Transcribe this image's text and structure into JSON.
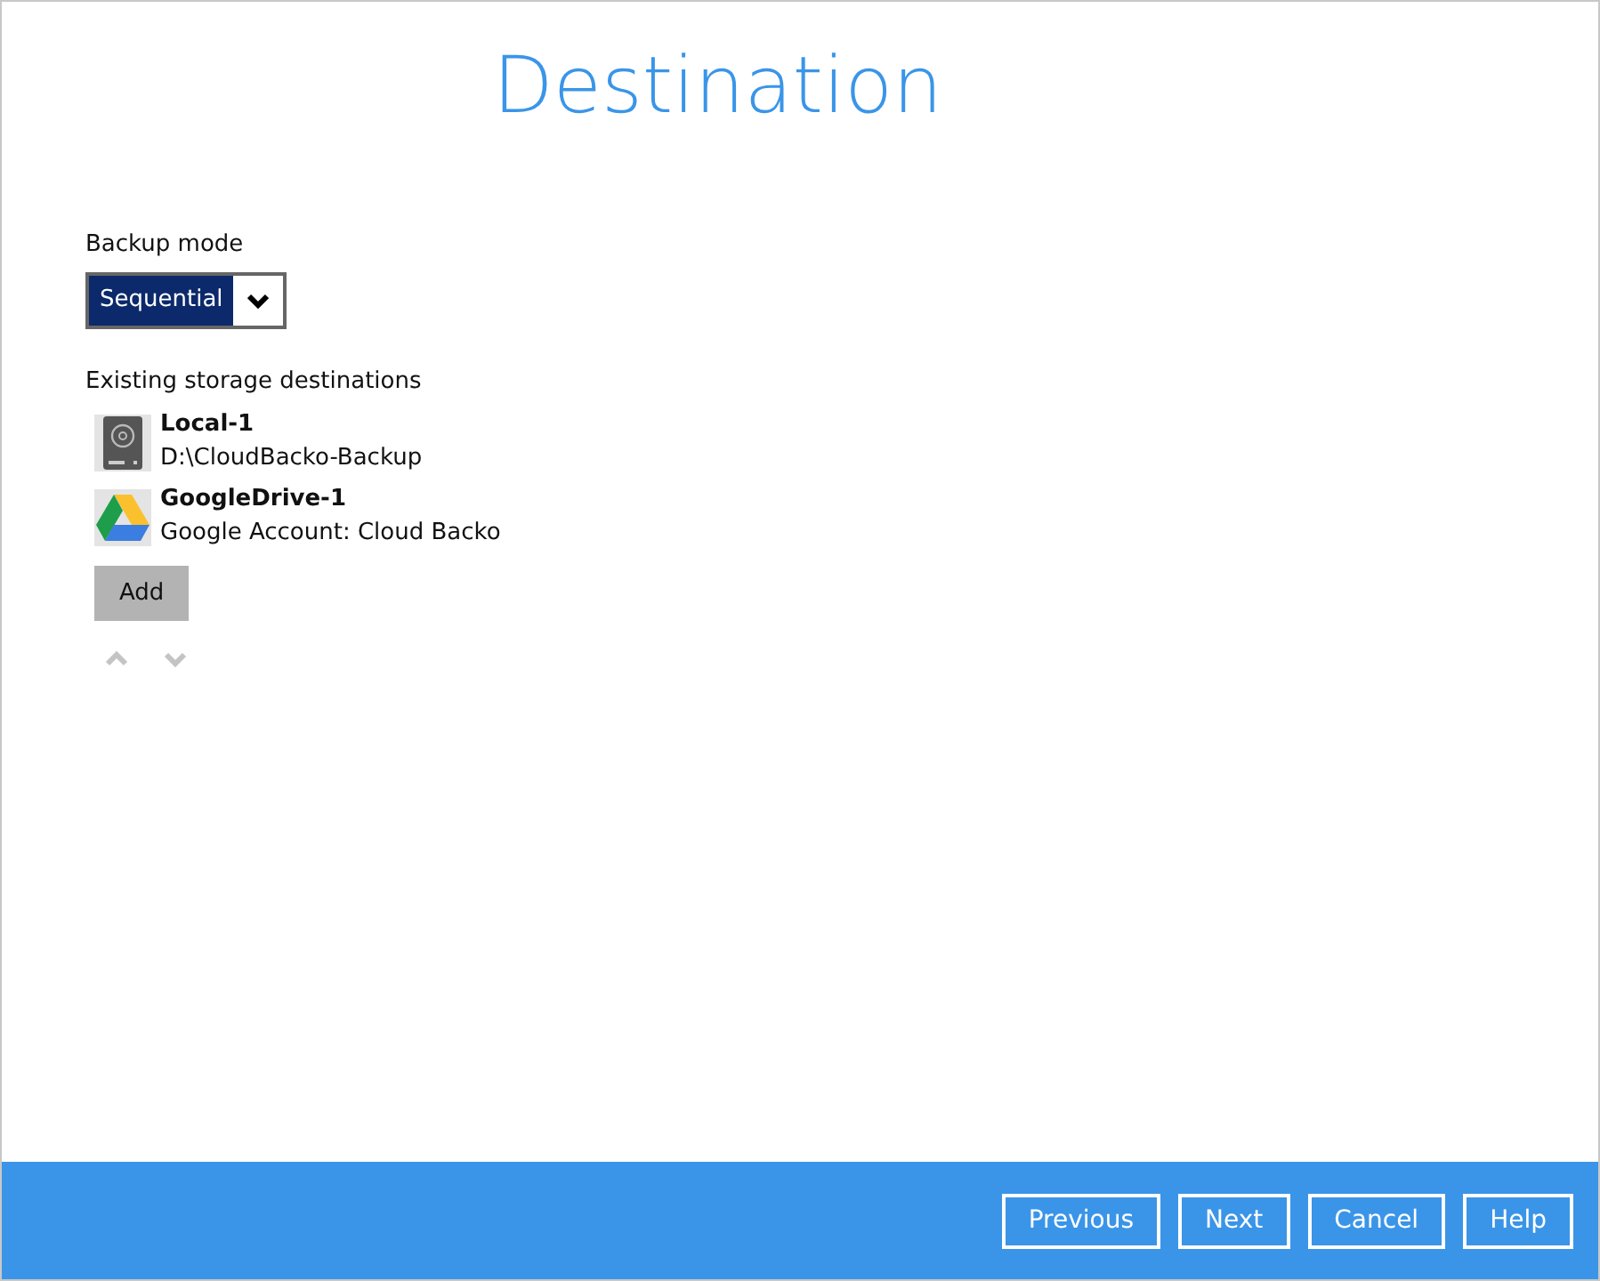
{
  "title": "Destination",
  "backup_mode": {
    "label": "Backup mode",
    "value": "Sequential"
  },
  "destinations": {
    "label": "Existing storage destinations",
    "items": [
      {
        "kind": "local",
        "name": "Local-1",
        "detail": "D:\\CloudBacko-Backup"
      },
      {
        "kind": "gdrive",
        "name": "GoogleDrive-1",
        "detail": "Google Account: Cloud Backo"
      }
    ],
    "add_button": "Add",
    "move_controls": [
      {
        "kind": "up",
        "disabled": true
      },
      {
        "kind": "down",
        "disabled": true
      }
    ]
  },
  "footer_buttons": [
    "Previous",
    "Next",
    "Cancel",
    "Help"
  ]
}
